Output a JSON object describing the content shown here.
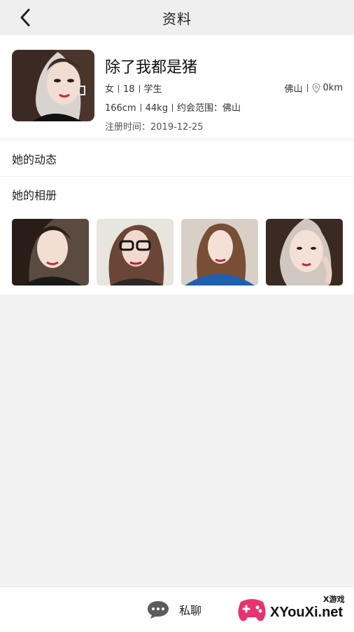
{
  "header": {
    "title": "资料",
    "back_icon": "chevron-left-icon"
  },
  "profile": {
    "nickname": "除了我都是猪",
    "gender": "女",
    "age": "18",
    "occupation": "学生",
    "city": "佛山",
    "distance": "0km",
    "height": "166cm",
    "weight": "44kg",
    "date_range": "约会范围：佛山",
    "registered": "注册时间：2019-12-25"
  },
  "sections": {
    "moments": "她的动态",
    "album": "她的相册"
  },
  "album": {
    "photos": [
      "photo-1",
      "photo-2",
      "photo-3",
      "photo-4"
    ]
  },
  "bottom": {
    "chat_label": "私聊",
    "chat_icon": "chat-bubble-icon"
  },
  "watermark": {
    "small": "X游戏",
    "big": "XYouXi.net"
  },
  "colors": {
    "header_bg": "#efefef",
    "page_bg": "#f2f2f2",
    "card_bg": "#ffffff",
    "accent_logo": "#e8336f"
  }
}
